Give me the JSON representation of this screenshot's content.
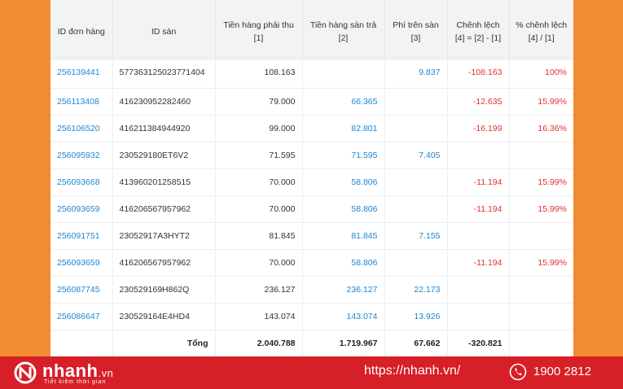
{
  "table": {
    "headers": [
      {
        "line1": "ID đơn hàng",
        "line2": ""
      },
      {
        "line1": "ID sàn",
        "line2": ""
      },
      {
        "line1": "Tiền hàng phải thu",
        "line2": "[1]"
      },
      {
        "line1": "Tiền hàng sàn trả",
        "line2": "[2]"
      },
      {
        "line1": "Phí trên sàn",
        "line2": "[3]"
      },
      {
        "line1": "Chênh lệch",
        "line2": "[4] = [2] - [1]"
      },
      {
        "line1": "% chênh lệch",
        "line2": "[4] / [1]"
      }
    ],
    "rows": [
      {
        "order_id": "256139441",
        "platform_id": "577363125023771404",
        "receivable": "108.163",
        "paid": "",
        "fee": "9.837",
        "diff": "-108.163",
        "pct": "100%"
      },
      {
        "order_id": "256113408",
        "platform_id": "416230952282460",
        "receivable": "79.000",
        "paid": "66.365",
        "fee": "",
        "diff": "-12.635",
        "pct": "15.99%"
      },
      {
        "order_id": "256106520",
        "platform_id": "416211384944920",
        "receivable": "99.000",
        "paid": "82.801",
        "fee": "",
        "diff": "-16.199",
        "pct": "16.36%"
      },
      {
        "order_id": "256095932",
        "platform_id": "230529180ET6V2",
        "receivable": "71.595",
        "paid": "71.595",
        "fee": "7.405",
        "diff": "",
        "pct": ""
      },
      {
        "order_id": "256093668",
        "platform_id": "413960201258515",
        "receivable": "70.000",
        "paid": "58.806",
        "fee": "",
        "diff": "-11.194",
        "pct": "15.99%"
      },
      {
        "order_id": "256093659",
        "platform_id": "416206567957962",
        "receivable": "70.000",
        "paid": "58.806",
        "fee": "",
        "diff": "-11.194",
        "pct": "15.99%"
      },
      {
        "order_id": "256091751",
        "platform_id": "23052917A3HYT2",
        "receivable": "81.845",
        "paid": "81.845",
        "fee": "7.155",
        "diff": "",
        "pct": ""
      },
      {
        "order_id": "256093659",
        "platform_id": "416206567957962",
        "receivable": "70.000",
        "paid": "58.806",
        "fee": "",
        "diff": "-11.194",
        "pct": "15.99%"
      },
      {
        "order_id": "256087745",
        "platform_id": "230529169H862Q",
        "receivable": "236.127",
        "paid": "236.127",
        "fee": "22.173",
        "diff": "",
        "pct": ""
      },
      {
        "order_id": "256086647",
        "platform_id": "230529164E4HD4",
        "receivable": "143.074",
        "paid": "143.074",
        "fee": "13.926",
        "diff": "",
        "pct": ""
      }
    ],
    "total": {
      "label": "Tổng",
      "receivable": "2.040.788",
      "paid": "1.719.967",
      "fee": "67.662",
      "diff": "-320.821"
    }
  },
  "footer": {
    "brand": "nhanh",
    "brand_suffix": ".vn",
    "slogan": "Tiết kiệm thời gian",
    "url": "https://nhanh.vn/",
    "phone": "1900 2812",
    "icons": [
      "nhanh-logo-icon",
      "phone-icon"
    ]
  },
  "colors": {
    "link": "#1f86d1",
    "negative": "#e0322d",
    "background": "#F28C33",
    "footer": "#D61F26"
  }
}
